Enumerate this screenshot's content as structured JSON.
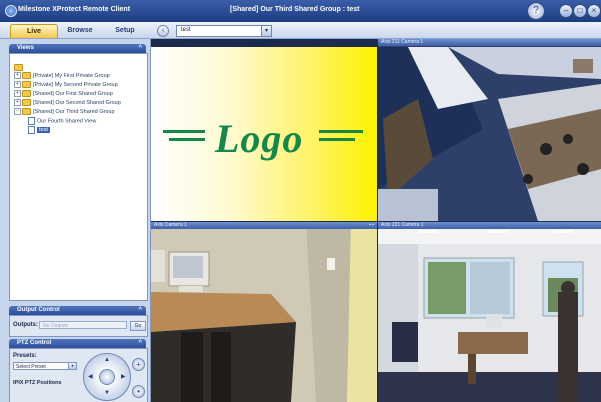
{
  "window": {
    "app_title": "Milestone XProtect Remote Client",
    "view_title": "[Shared] Our Third Shared Group : test"
  },
  "tabs": [
    {
      "label": "Live"
    },
    {
      "label": "Browse"
    },
    {
      "label": "Setup"
    }
  ],
  "toolbar": {
    "view_select_value": "test"
  },
  "views_panel": {
    "title": "Views",
    "tree": [
      {
        "label": "[Private] My First Private Group"
      },
      {
        "label": "[Private] My Second Private Group"
      },
      {
        "label": "[Shared] Our First Shared Group"
      },
      {
        "label": "[Shared] Our Second Shared Group"
      },
      {
        "label": "[Shared] Our Third Shared Group"
      },
      {
        "label": "Our Fourth Shared View"
      },
      {
        "label": "test"
      }
    ]
  },
  "output_panel": {
    "title": "Output Control",
    "outputs_label": "Outputs:",
    "outputs_placeholder": "No Outputs",
    "button_label": "Go"
  },
  "ptz_panel": {
    "title": "PTZ Control",
    "presets_label": "Presets:",
    "preset_value": "Select Preset",
    "ipix_label": "IPIX PTZ Positions"
  },
  "cameras": [
    {
      "title": "Axis 211 Camera 1"
    },
    {
      "title": "Axis Camera 1"
    },
    {
      "title": "Axis 221 Camera 1"
    }
  ],
  "logo": {
    "text": "Logo"
  }
}
